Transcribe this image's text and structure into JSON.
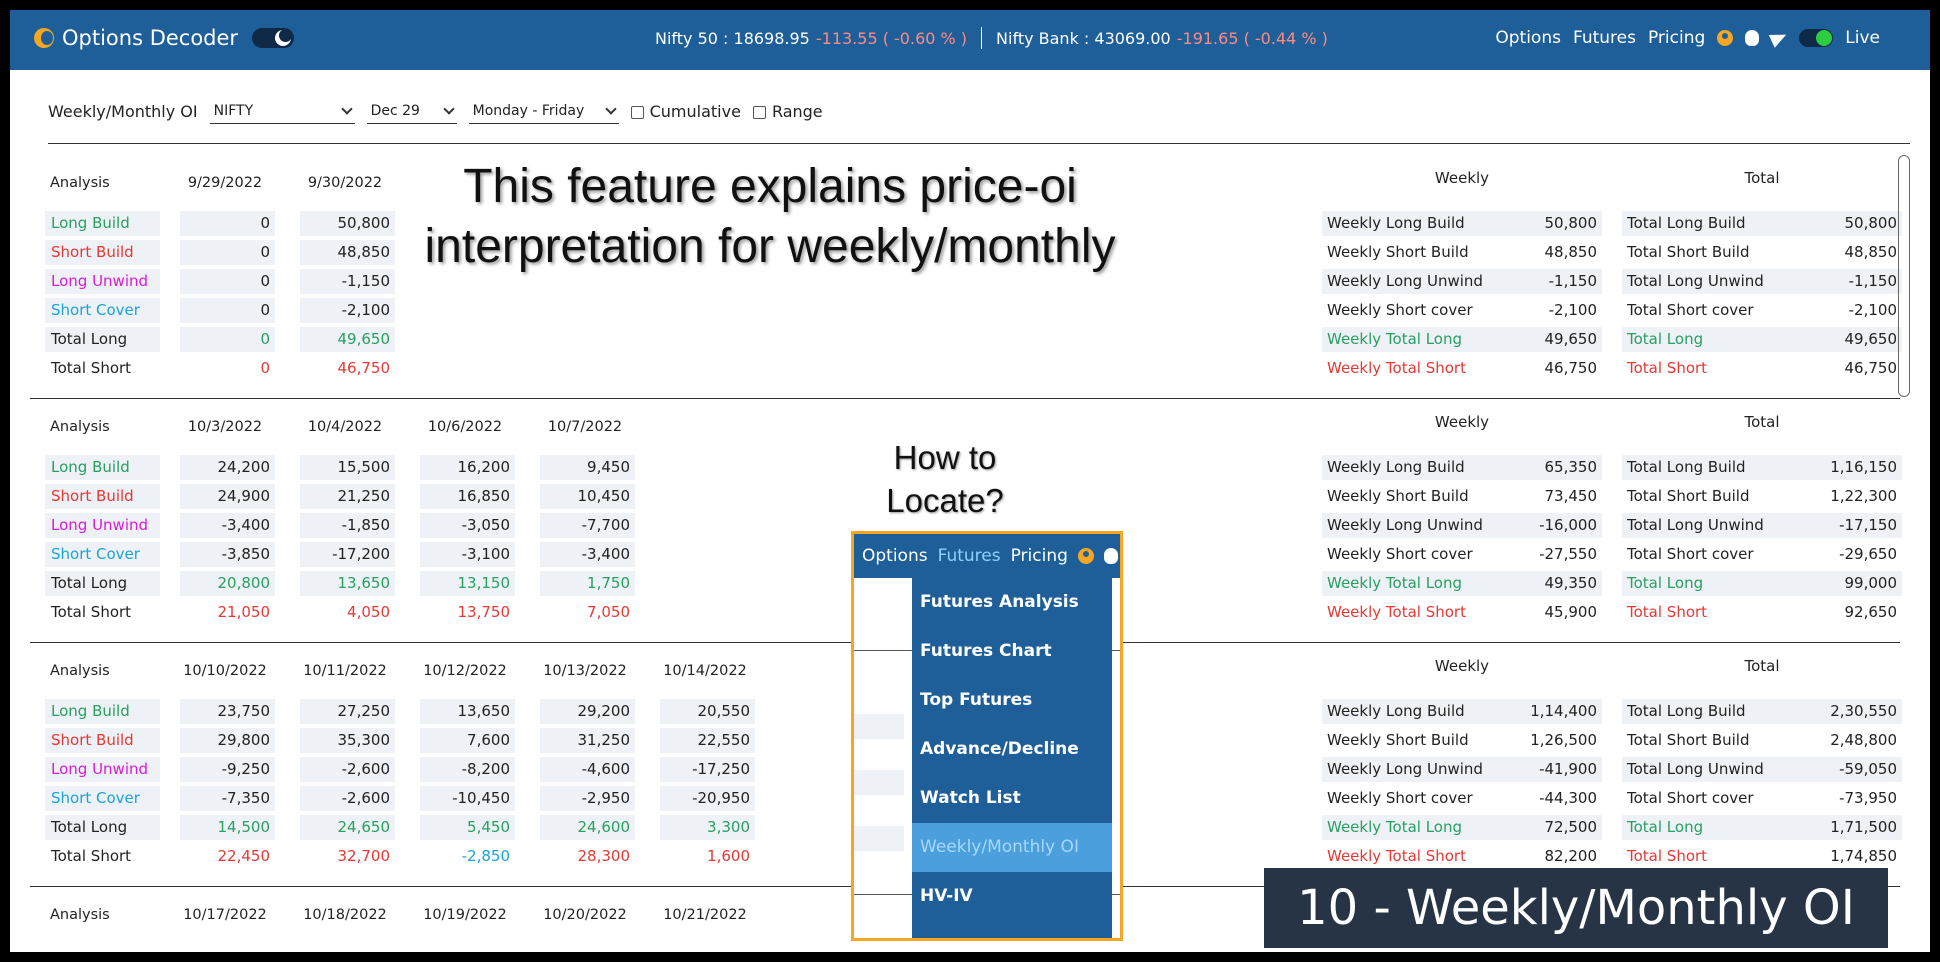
{
  "navbar": {
    "brand": "Options Decoder",
    "nifty_label": "Nifty 50 : 18698.95",
    "nifty_change": "-113.55 ( -0.60 % )",
    "bank_label": "Nifty Bank : 43069.00",
    "bank_change": "-191.65 ( -0.44 % )",
    "links": [
      "Options",
      "Futures",
      "Pricing"
    ],
    "live_label": "Live"
  },
  "filters": {
    "title": "Weekly/Monthly OI",
    "symbol": "NIFTY",
    "expiry": "Dec 29",
    "days": "Monday - Friday",
    "cumulative_label": "Cumulative",
    "range_label": "Range"
  },
  "row_labels": [
    "Long Build",
    "Short Build",
    "Long Unwind",
    "Short Cover",
    "Total Long",
    "Total Short"
  ],
  "weekly_labels": [
    "Weekly Long Build",
    "Weekly Short Build",
    "Weekly Long Unwind",
    "Weekly Short cover",
    "Weekly Total Long",
    "Weekly Total Short"
  ],
  "total_labels": [
    "Total Long Build",
    "Total Short Build",
    "Total Long Unwind",
    "Total Short cover",
    "Total Long",
    "Total Short"
  ],
  "blocks": [
    {
      "analysis": "Analysis",
      "dates": [
        "9/29/2022",
        "9/30/2022"
      ],
      "cols": [
        [
          "0",
          "0",
          "0",
          "0",
          "0",
          "0"
        ],
        [
          "50,800",
          "48,850",
          "-1,150",
          "-2,100",
          "49,650",
          "46,750"
        ]
      ],
      "weekly_hdr": "Weekly",
      "total_hdr": "Total",
      "weekly": [
        "50,800",
        "48,850",
        "-1,150",
        "-2,100",
        "49,650",
        "46,750"
      ],
      "total": [
        "50,800",
        "48,850",
        "-1,150",
        "-2,100",
        "49,650",
        "46,750"
      ]
    },
    {
      "analysis": "Analysis",
      "dates": [
        "10/3/2022",
        "10/4/2022",
        "10/6/2022",
        "10/7/2022"
      ],
      "cols": [
        [
          "24,200",
          "24,900",
          "-3,400",
          "-3,850",
          "20,800",
          "21,050"
        ],
        [
          "15,500",
          "21,250",
          "-1,850",
          "-17,200",
          "13,650",
          "4,050"
        ],
        [
          "16,200",
          "16,850",
          "-3,050",
          "-3,100",
          "13,150",
          "13,750"
        ],
        [
          "9,450",
          "10,450",
          "-7,700",
          "-3,400",
          "1,750",
          "7,050"
        ]
      ],
      "weekly_hdr": "Weekly",
      "total_hdr": "Total",
      "weekly": [
        "65,350",
        "73,450",
        "-16,000",
        "-27,550",
        "49,350",
        "45,900"
      ],
      "total": [
        "1,16,150",
        "1,22,300",
        "-17,150",
        "-29,650",
        "99,000",
        "92,650"
      ]
    },
    {
      "analysis": "Analysis",
      "dates": [
        "10/10/2022",
        "10/11/2022",
        "10/12/2022",
        "10/13/2022",
        "10/14/2022"
      ],
      "cols": [
        [
          "23,750",
          "29,800",
          "-9,250",
          "-7,350",
          "14,500",
          "22,450"
        ],
        [
          "27,250",
          "35,300",
          "-2,600",
          "-2,600",
          "24,650",
          "32,700"
        ],
        [
          "13,650",
          "7,600",
          "-8,200",
          "-10,450",
          "5,450",
          "-2,850"
        ],
        [
          "29,200",
          "31,250",
          "-4,600",
          "-2,950",
          "24,600",
          "28,300"
        ],
        [
          "20,550",
          "22,550",
          "-17,250",
          "-20,950",
          "3,300",
          "1,600"
        ]
      ],
      "weekly_hdr": "Weekly",
      "total_hdr": "Total",
      "weekly": [
        "1,14,400",
        "1,26,500",
        "-41,900",
        "-44,300",
        "72,500",
        "82,200"
      ],
      "total": [
        "2,30,550",
        "2,48,800",
        "-59,050",
        "-73,950",
        "1,71,500",
        "1,74,850"
      ]
    },
    {
      "analysis": "Analysis",
      "dates": [
        "10/17/2022",
        "10/18/2022",
        "10/19/2022",
        "10/20/2022",
        "10/21/2022"
      ]
    }
  ],
  "overlay": {
    "feature_note": "This feature explains price-oi interpretation for weekly/monthly",
    "howto": "How to Locate?",
    "mini_nav": [
      "Options",
      "Futures",
      "Pricing"
    ],
    "dropdown": [
      "Futures Analysis",
      "Futures Chart",
      "Top Futures",
      "Advance/Decline",
      "Watch List",
      "Weekly/Monthly OI",
      "HV-IV"
    ],
    "caption": "10 - Weekly/Monthly OI"
  }
}
